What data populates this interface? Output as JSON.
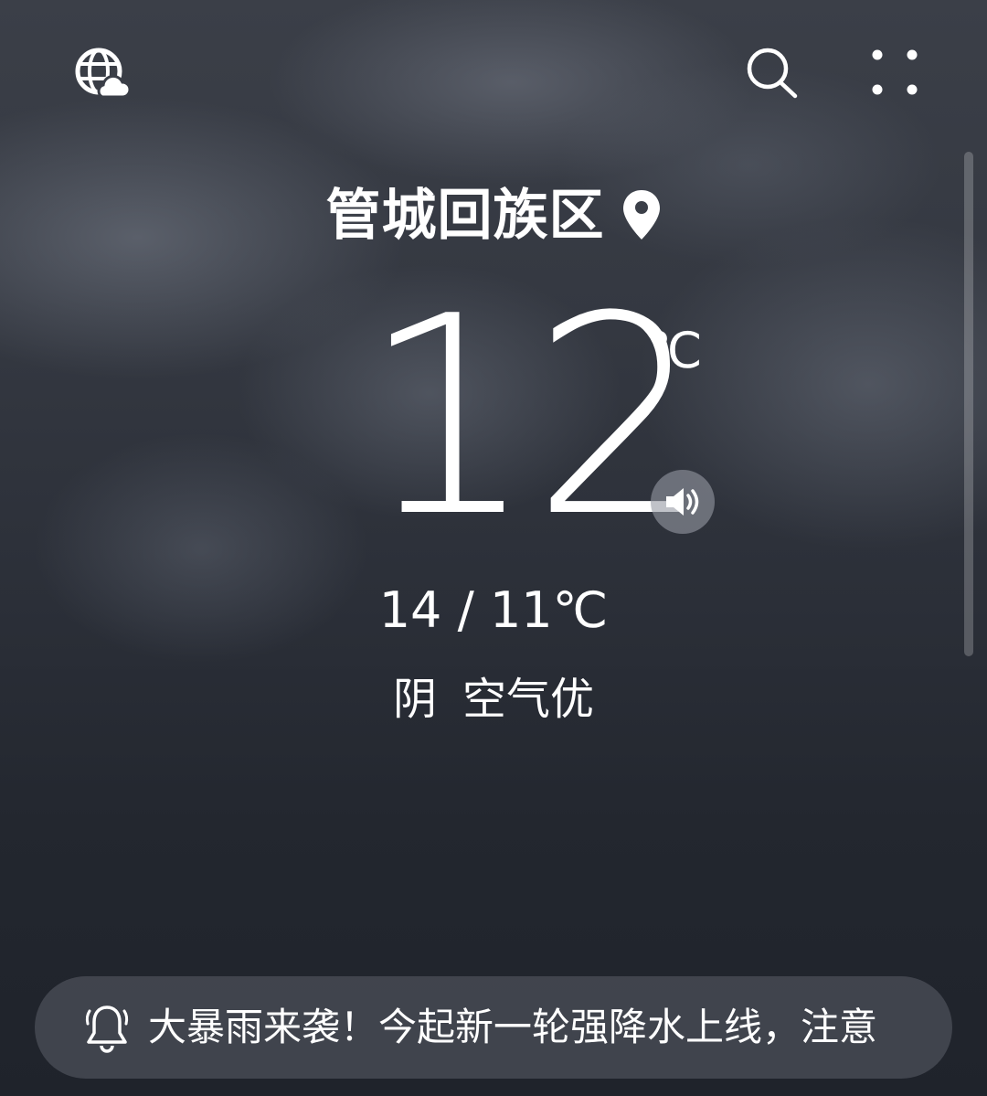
{
  "header": {
    "icons": [
      "globe-cloud-icon",
      "search-icon",
      "more-dots-icon"
    ]
  },
  "location": {
    "name": "管城回族区",
    "icon": "location-pin-icon"
  },
  "current": {
    "temperature": "12",
    "unit": "℃",
    "speaker_icon": "speaker-icon"
  },
  "range": "14 / 11℃",
  "condition": {
    "weather": "阴",
    "air_quality": "空气优"
  },
  "alert": {
    "icon": "bell-alert-icon",
    "text": "大暴雨来袭！今起新一轮强降水上线，注意"
  }
}
